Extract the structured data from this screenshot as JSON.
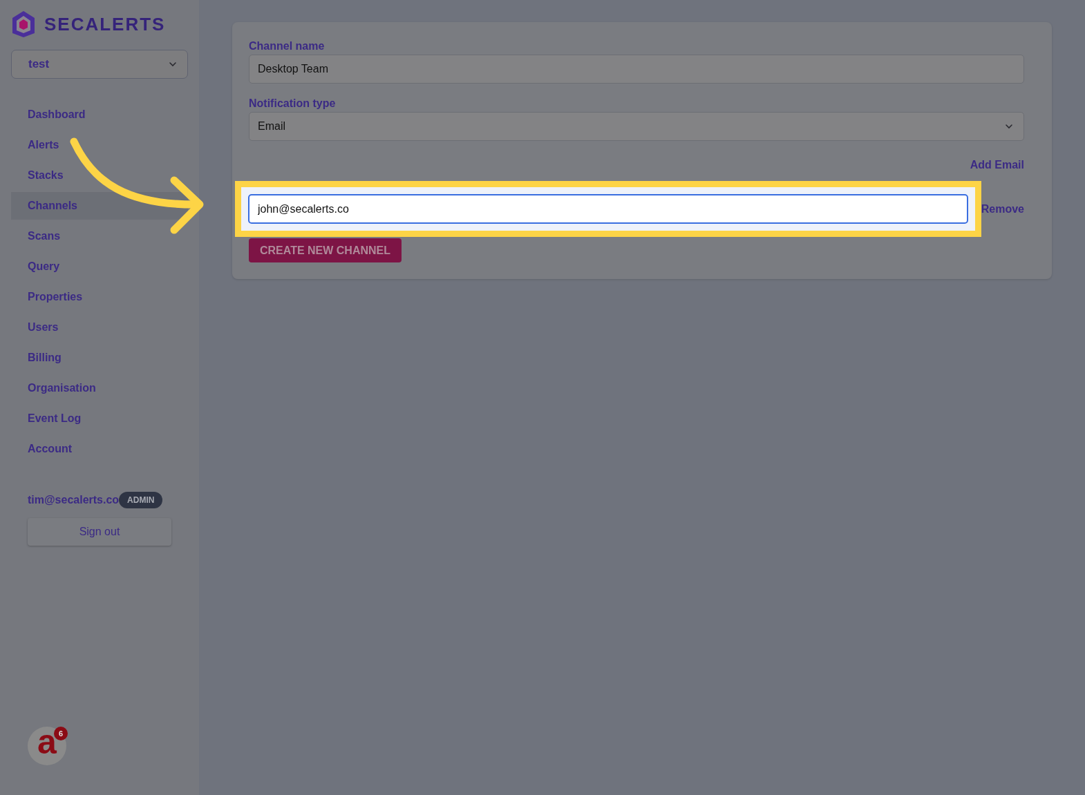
{
  "brand": {
    "name": "SECALERTS"
  },
  "workspace": {
    "value": "test"
  },
  "nav": [
    {
      "label": "Dashboard",
      "selected": false
    },
    {
      "label": "Alerts",
      "selected": false
    },
    {
      "label": "Stacks",
      "selected": false
    },
    {
      "label": "Channels",
      "selected": true
    },
    {
      "label": "Scans",
      "selected": false
    },
    {
      "label": "Query",
      "selected": false
    },
    {
      "label": "Properties",
      "selected": false
    },
    {
      "label": "Users",
      "selected": false
    },
    {
      "label": "Billing",
      "selected": false
    },
    {
      "label": "Organisation",
      "selected": false
    },
    {
      "label": "Event Log",
      "selected": false
    },
    {
      "label": "Account",
      "selected": false
    }
  ],
  "user": {
    "email": "tim@secalerts.co",
    "role": "ADMIN"
  },
  "sign_out": "Sign out",
  "help_widget": {
    "letter": "a",
    "badge": "6"
  },
  "form": {
    "channel_name": {
      "label": "Channel name",
      "value": "Desktop Team"
    },
    "notification_type": {
      "label": "Notification type",
      "value": "Email"
    },
    "add_email": "Add Email",
    "emails": [
      {
        "value": "john@secalerts.co",
        "highlighted": true,
        "remove": "Remove"
      }
    ],
    "submit": "CREATE NEW CHANNEL"
  }
}
